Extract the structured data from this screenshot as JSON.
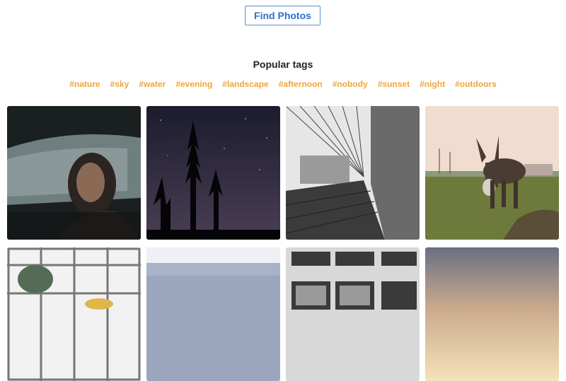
{
  "search": {
    "button_label": "Find Photos"
  },
  "popular_tags": {
    "title": "Popular tags",
    "tags": [
      "#nature",
      "#sky",
      "#water",
      "#evening",
      "#landscape",
      "#afternoon",
      "#nobody",
      "#sunset",
      "#night",
      "#outdoors"
    ]
  },
  "photos": [
    {
      "subject": "woman in car"
    },
    {
      "subject": "pine trees under night sky"
    },
    {
      "subject": "bridge walkway black and white"
    },
    {
      "subject": "donkey in field"
    },
    {
      "subject": "window panes"
    },
    {
      "subject": "sea horizon"
    },
    {
      "subject": "old building windows"
    },
    {
      "subject": "warm sunset sky"
    }
  ]
}
